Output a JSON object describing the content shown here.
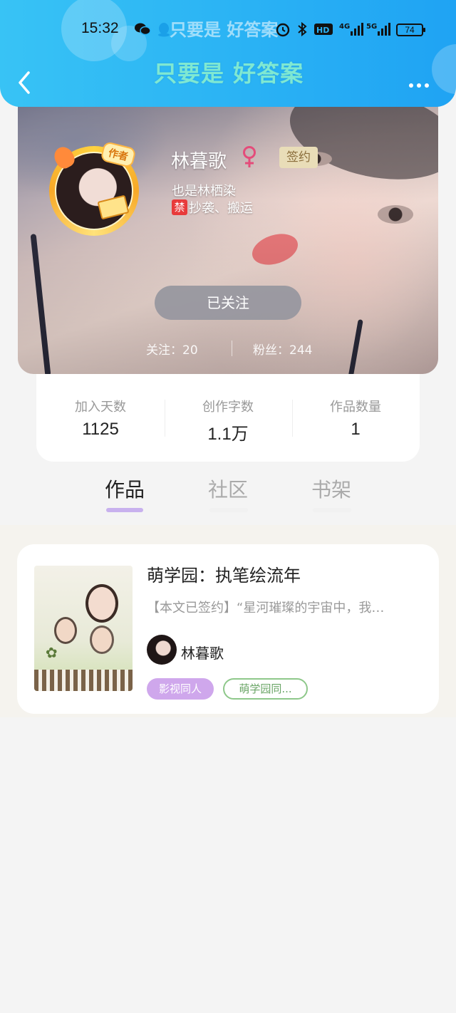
{
  "status_bar": {
    "time": "15:32",
    "ghost_text": "只要是 好答案",
    "battery": "74",
    "icons": [
      "wechat-icon",
      "qq-icon",
      "alarm-icon",
      "bluetooth-icon",
      "hd-icon",
      "signal-4g-icon",
      "signal-5g-icon",
      "battery-icon"
    ]
  },
  "header": {
    "title": "只要是 好答案",
    "back_icon": "chevron-left-icon",
    "more_icon": "more-icon"
  },
  "profile": {
    "author_badge": "作者",
    "name": "林暮歌",
    "gender_icon": "female-icon",
    "signed_label": "签约",
    "alias": "也是林栖染",
    "ban_badge": "禁",
    "ban_text": "抄袭、搬运",
    "follow_button": "已关注",
    "following": "关注：20",
    "fans": "粉丝：244"
  },
  "stats": [
    {
      "label": "加入天数",
      "value": "1125"
    },
    {
      "label": "创作字数",
      "value": "1.1万"
    },
    {
      "label": "作品数量",
      "value": "1"
    }
  ],
  "tabs": [
    {
      "label": "作品",
      "active": true
    },
    {
      "label": "社区",
      "active": false
    },
    {
      "label": "书架",
      "active": false
    }
  ],
  "works": [
    {
      "title": "萌学园：执笔绘流年",
      "description": "【本文已签约】“星河璀璨的宇宙中，我…",
      "author": "林暮歌",
      "tags": [
        "影视同人",
        "萌学园同..."
      ]
    }
  ],
  "colors": {
    "header_start": "#38c3f5",
    "header_end": "#1fa3f3",
    "tab_indicator": "#c8b1ee",
    "tag_primary": "#cfa7ec",
    "tag_outline": "#8ec88a",
    "ban_red": "#e83b3b"
  }
}
